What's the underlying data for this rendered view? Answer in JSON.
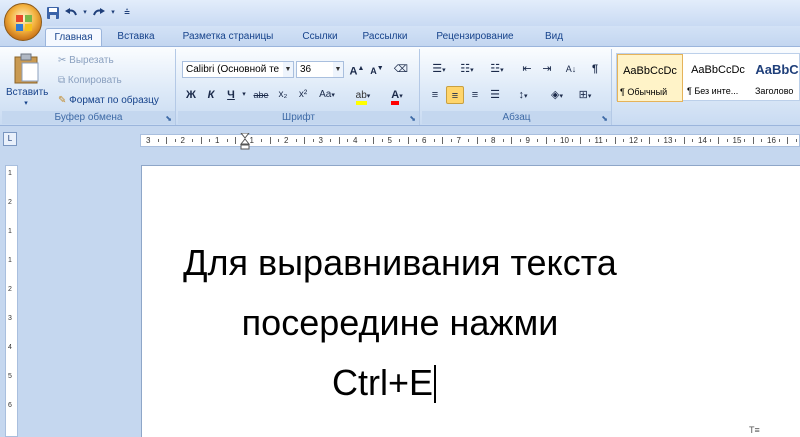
{
  "qat": {
    "icons": [
      "save-icon",
      "undo-icon",
      "redo-icon",
      "customize-icon"
    ]
  },
  "tabs": [
    "Главная",
    "Вставка",
    "Разметка страницы",
    "Ссылки",
    "Рассылки",
    "Рецензирование",
    "Вид"
  ],
  "clipboard": {
    "paste": "Вставить",
    "cut": "Вырезать",
    "copy": "Копировать",
    "format_painter": "Формат по образцу",
    "label": "Буфер обмена"
  },
  "font": {
    "name": "Calibri (Основной те",
    "size": "36",
    "label": "Шрифт",
    "bold": "Ж",
    "italic": "К",
    "underline": "Ч",
    "strike": "abe",
    "subscript": "x₂",
    "superscript": "x²",
    "case": "Aa",
    "grow": "A",
    "shrink": "A",
    "color_letter": "A"
  },
  "paragraph": {
    "label": "Абзац",
    "alignment": "center"
  },
  "styles": [
    {
      "sample": "AaBbCcDc",
      "name": "¶ Обычный"
    },
    {
      "sample": "AaBbCcDc",
      "name": "¶ Без инте..."
    },
    {
      "sample": "AaBbC",
      "name": "Заголово"
    }
  ],
  "ruler": {
    "labels": [
      "3",
      "2",
      "1",
      "1",
      "2",
      "3",
      "4",
      "5",
      "6",
      "7",
      "8",
      "9",
      "10",
      "11",
      "12",
      "13",
      "14",
      "15",
      "16"
    ],
    "vertical_labels": [
      "1",
      "2",
      "1",
      "1",
      "2",
      "3",
      "4",
      "5",
      "6"
    ]
  },
  "document": {
    "lines": [
      "Для выравнивания текста",
      "посередине нажми",
      "Ctrl+E"
    ]
  },
  "colors": {
    "ribbon_text": "#15428b",
    "highlight": "#ffff00",
    "font_color": "#ff0000"
  }
}
